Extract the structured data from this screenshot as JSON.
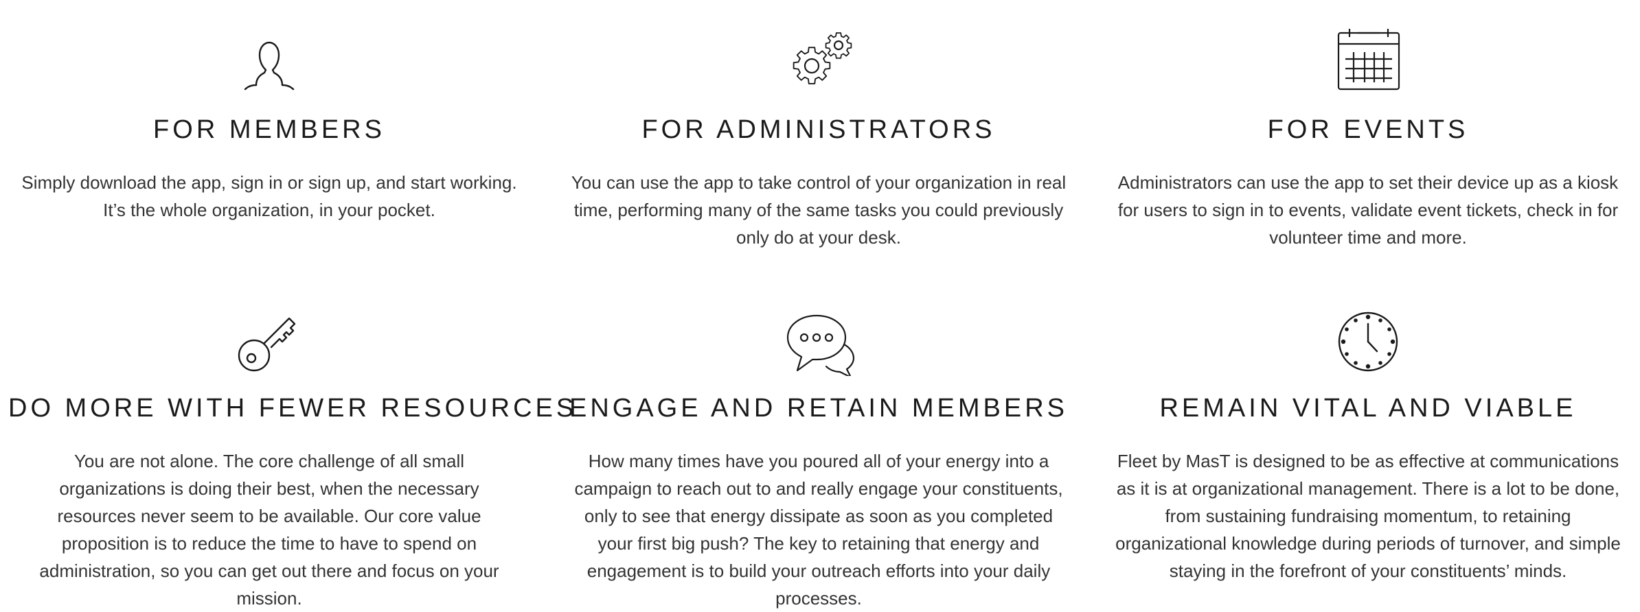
{
  "features": [
    {
      "icon": "person-icon",
      "title": "FOR MEMBERS",
      "description": "Simply download the app, sign in or sign up, and start working. It’s the whole organization, in your pocket."
    },
    {
      "icon": "gears-icon",
      "title": "FOR ADMINISTRATORS",
      "description": "You can use the app to take control of your organization in real time, performing many of the same tasks you could previously only do at your desk."
    },
    {
      "icon": "calendar-icon",
      "title": "FOR EVENTS",
      "description": "Administrators can use the app to set their device up as a kiosk for users to sign in to events, validate event tickets, check in for volunteer time and more."
    },
    {
      "icon": "key-icon",
      "title": "DO MORE WITH FEWER RESOURCES",
      "description": "You are not alone. The core challenge of all small organizations is doing their best, when the necessary resources never seem to be available. Our core value proposition is to reduce the time to have to spend on administration, so you can get out there and focus on your mission."
    },
    {
      "icon": "chat-bubbles-icon",
      "title": "ENGAGE AND RETAIN MEMBERS",
      "description": "How many times have you poured all of your energy into a campaign to reach out to and really engage your constituents, only to see that energy dissipate as soon as you completed your first big push? The key to retaining that energy and engagement is to build your outreach efforts into your daily processes."
    },
    {
      "icon": "clock-icon",
      "title": "REMAIN VITAL AND VIABLE",
      "description": "Fleet by MasT is designed to be as effective at communications as it is at organizational management. There is a lot to be done, from sustaining fundraising momentum, to retaining organizational knowledge during periods of turnover, and simple staying in the forefront of your constituents’ minds."
    }
  ],
  "colors": {
    "background": "#ffffff",
    "text": "#1a1a1a",
    "icon_stroke": "#1a1a1a"
  }
}
